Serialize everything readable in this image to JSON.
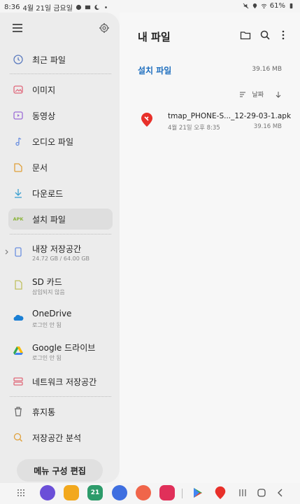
{
  "status_bar": {
    "time": "8:36",
    "date": "4월 21일 금요일",
    "battery": "61%"
  },
  "drawer": {
    "items": [
      {
        "label": "최근 파일",
        "icon": "clock-icon"
      },
      {
        "label": "이미지",
        "icon": "image-icon"
      },
      {
        "label": "동영상",
        "icon": "video-icon"
      },
      {
        "label": "오디오 파일",
        "icon": "music-icon"
      },
      {
        "label": "문서",
        "icon": "document-icon"
      },
      {
        "label": "다운로드",
        "icon": "download-icon"
      },
      {
        "label": "설치 파일",
        "icon": "apk-icon",
        "icon_text": "APK"
      }
    ],
    "storage": [
      {
        "label": "내장 저장공간",
        "sub": "24.72 GB / 64.00 GB",
        "icon": "phone-storage-icon"
      },
      {
        "label": "SD 카드",
        "sub": "삽입되지 않음",
        "icon": "sd-card-icon"
      },
      {
        "label": "OneDrive",
        "sub": "로그인 안 됨",
        "icon": "onedrive-icon"
      },
      {
        "label": "Google 드라이브",
        "sub": "로그인 안 됨",
        "icon": "google-drive-icon"
      },
      {
        "label": "네트워크 저장공간",
        "icon": "network-storage-icon"
      }
    ],
    "extras": [
      {
        "label": "휴지통",
        "icon": "trash-icon"
      },
      {
        "label": "저장공간 분석",
        "icon": "storage-analysis-icon"
      }
    ],
    "edit_button": "메뉴 구성 편집"
  },
  "main": {
    "title": "내 파일",
    "section_title": "설치 파일",
    "section_size": "39.16 MB",
    "sort_label": "날짜",
    "files": [
      {
        "name": "tmap_PHONE-S..._12-29-03-1.apk",
        "date": "4월 21일 오후 8:35",
        "size": "39.16 MB"
      }
    ]
  },
  "colors": {
    "accent": "#1f6fbf",
    "drawer_bg": "#ececec",
    "main_bg": "#f7f7f7"
  }
}
